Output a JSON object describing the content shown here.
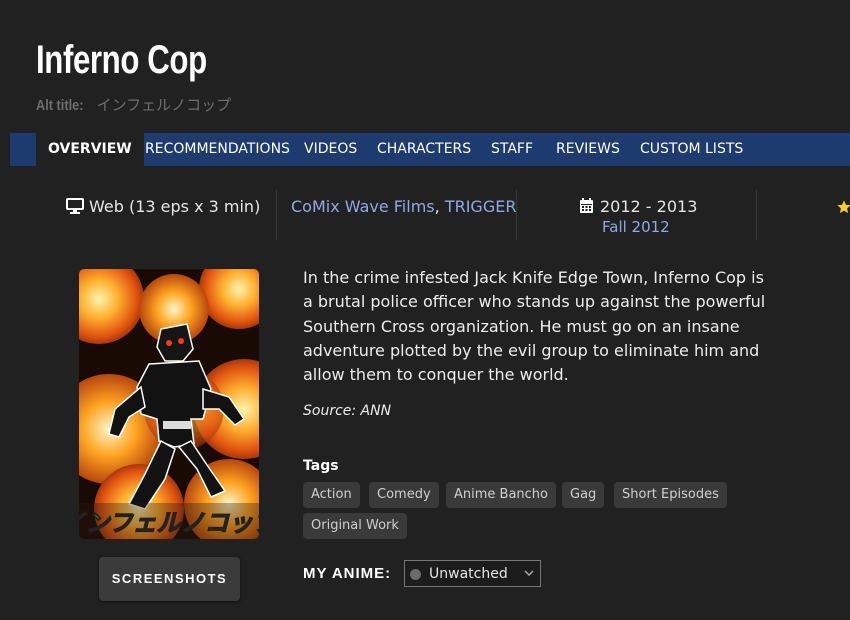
{
  "header": {
    "title": "Inferno Cop",
    "alt_title_label": "Alt title:",
    "alt_title_value": "インフェルノコップ"
  },
  "nav": {
    "tabs": [
      {
        "label": "OVERVIEW",
        "active": true
      },
      {
        "label": "RECOMMENDATIONS",
        "active": false
      },
      {
        "label": "VIDEOS",
        "active": false
      },
      {
        "label": "CHARACTERS",
        "active": false
      },
      {
        "label": "STAFF",
        "active": false
      },
      {
        "label": "REVIEWS",
        "active": false
      },
      {
        "label": "CUSTOM LISTS",
        "active": false
      }
    ]
  },
  "info": {
    "format": "Web (13 eps x 3 min)",
    "studios": [
      "CoMix Wave Films",
      "TRIGGER"
    ],
    "studio_separator": ",",
    "years": "2012 - 2013",
    "season": "Fall 2012"
  },
  "poster": {
    "logo_text": "インフェルノコップ"
  },
  "buttons": {
    "screenshots": "SCREENSHOTS"
  },
  "synopsis": {
    "text": "In the crime infested Jack Knife Edge Town, Inferno Cop is a brutal police officer who stands up against the powerful Southern Cross organization. He must go on an insane adventure plotted by the evil group to eliminate him and allow them to conquer the world.",
    "source": "Source: ANN"
  },
  "tags": {
    "heading": "Tags",
    "items": [
      "Action",
      "Comedy",
      "Anime Bancho",
      "Gag",
      "Short Episodes",
      "Original Work"
    ]
  },
  "my_anime": {
    "label": "MY ANIME:",
    "status": "Unwatched",
    "status_color": "#6b6b6b"
  },
  "colors": {
    "background": "#212121",
    "nav_bar": "#1d3b6e",
    "link": "#8fa9e8",
    "star": "#f2d024"
  }
}
